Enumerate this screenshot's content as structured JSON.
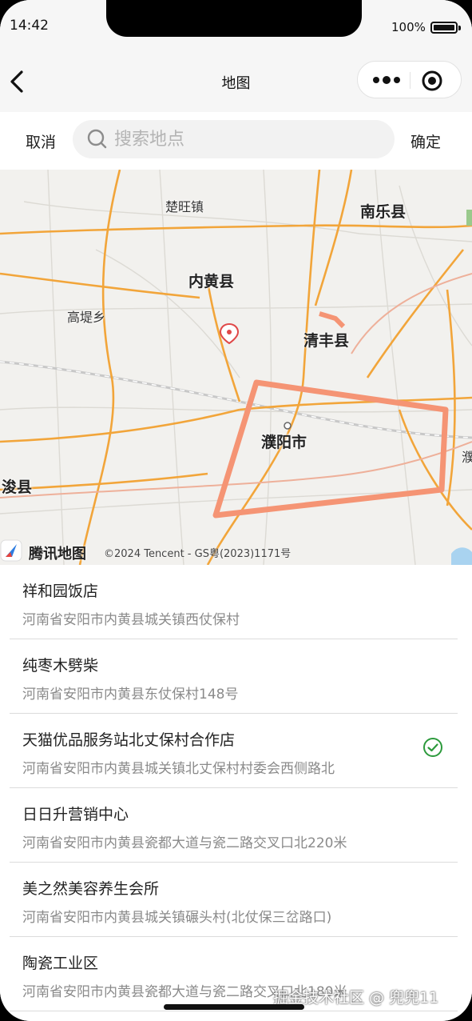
{
  "status_bar": {
    "time": "14:42",
    "battery": "100%"
  },
  "nav": {
    "title": "地图",
    "more_icon": "more-dots-icon",
    "close_icon": "target-circle-icon"
  },
  "search": {
    "cancel_label": "取消",
    "placeholder": "搜索地点",
    "value": "",
    "confirm_label": "确定"
  },
  "map": {
    "labels": {
      "chuwang": "楚旺镇",
      "nanle": "南乐县",
      "neihuang": "内黄县",
      "gaodi": "高堤乡",
      "qingfeng": "清丰县",
      "puyang": "濮阳市",
      "junxian": "浚县",
      "pu_edge": "濮"
    },
    "logo_text": "腾讯地图",
    "copyright": "©2024 Tencent - GS粤(2023)1171号",
    "colors": {
      "road": "#f2a53a",
      "boundary": "#f59474",
      "marker": "#e04848",
      "background": "#f2f1ee"
    }
  },
  "poi_list": [
    {
      "name": "祥和园饭店",
      "address": "河南省安阳市内黄县城关镇西仗保村",
      "selected": false
    },
    {
      "name": "纯枣木劈柴",
      "address": "河南省安阳市内黄县东仗保村148号",
      "selected": false
    },
    {
      "name": "天猫优品服务站北丈保村合作店",
      "address": "河南省安阳市内黄县城关镇北丈保村村委会西侧路北",
      "selected": true
    },
    {
      "name": "日日升营销中心",
      "address": "河南省安阳市内黄县瓷都大道与瓷二路交叉口北220米",
      "selected": false
    },
    {
      "name": "美之然美容养生会所",
      "address": "河南省安阳市内黄县城关镇碾头村(北仗保三岔路口)",
      "selected": false
    },
    {
      "name": "陶瓷工业区",
      "address": "河南省安阳市内黄县瓷都大道与瓷二路交叉口北180米",
      "selected": false
    }
  ],
  "accent_color": "#2c9a3c",
  "watermark": "掘金技术社区 @ 兜兜11"
}
